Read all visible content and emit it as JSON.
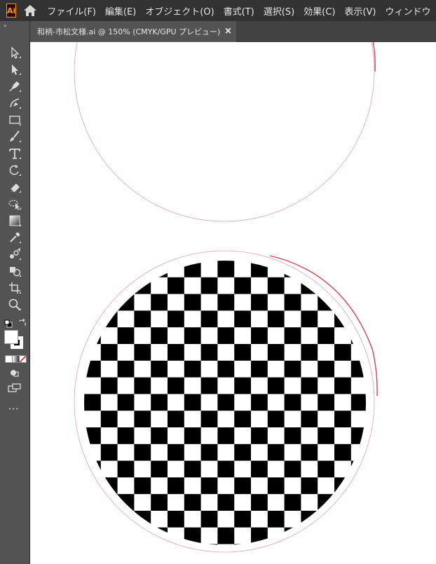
{
  "app": {
    "logo_text": "Ai"
  },
  "menu": [
    "ファイル(F)",
    "編集(E)",
    "オブジェクト(O)",
    "書式(T)",
    "選択(S)",
    "効果(C)",
    "表示(V)",
    "ウィンドウ"
  ],
  "tab": {
    "title": "和柄-市松文様.ai @ 150% (CMYK/GPU プレビュー)",
    "close_glyph": "×"
  },
  "toolbar": {
    "collapse_glyph": "»",
    "more_glyph": "•••",
    "tools": [
      "selection-tool",
      "direct-selection-tool",
      "pen-tool",
      "curvature-tool",
      "rectangle-tool",
      "paintbrush-tool",
      "type-tool",
      "rotate-tool",
      "eraser-tool",
      "puppet-warp-tool",
      "gradient-tool",
      "eyedropper-tool",
      "blend-tool",
      "shape-builder-tool",
      "artboard-tool",
      "zoom-tool"
    ]
  },
  "colors": {
    "menubar": "#323232",
    "panel": "#535353",
    "tab_bar": "#424242",
    "canvas": "#ffffff",
    "guide": "#e06470",
    "checker": "#000000"
  }
}
